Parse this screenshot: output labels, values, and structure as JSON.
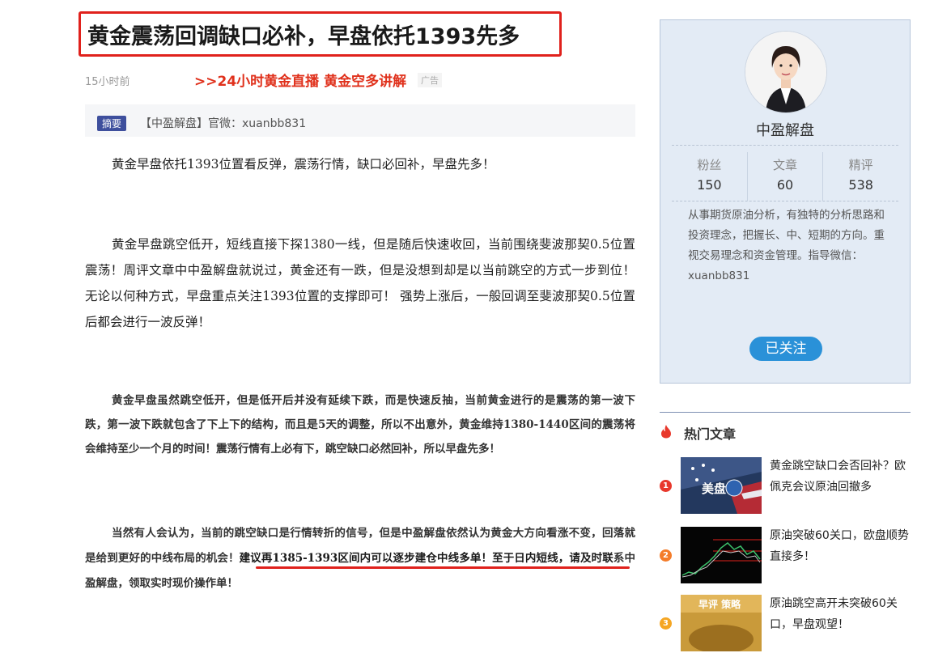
{
  "article": {
    "title": "黄金震荡回调缺口必补，早盘依托1393先多",
    "time": "15小时前",
    "ad_link": ">>24小时黄金直播 黄金空多讲解",
    "ad_tag": "广告",
    "summary_tag": "摘要",
    "summary_text": "【中盈解盘】官微：xuanbb831",
    "p1": "黄金早盘依托1393位置看反弹，震荡行情，缺口必回补，早盘先多！",
    "p2": "黄金早盘跳空低开，短线直接下探1380一线，但是随后快速收回，当前围绕斐波那契0.5位置震荡！周评文章中中盈解盘就说过，黄金还有一跌，但是没想到却是以当前跳空的方式一步到位！无论以何种方式，早盘重点关注1393位置的支撑即可！ 强势上涨后，一般回调至斐波那契0.5位置后都会进行一波反弹！",
    "p3": "黄金早盘虽然跳空低开，但是低开后并没有延续下跌，而是快速反抽，当前黄金进行的是震荡的第一波下跌，第一波下跌就包含了下上下的结构，而且是5天的调整，所以不出意外，黄金维持1380-1440区间的震荡将会维持至少一个月的时间！震荡行情有上必有下，跳空缺口必然回补，所以早盘先多！",
    "p4_a": "当然有人会认为，当前的跳空缺口是行情转折的信号，但是中盈解盘依然认为黄金大方向看涨不变，回落就是给到更好的中线布局的机会！",
    "p4_b": "建议再1385-1393区间内可以逐步建仓中线多单！至于日内短线，请及时联",
    "p4_c": "系中盈解盘，领取实时现价操作单！"
  },
  "author": {
    "name": "中盈解盘",
    "stats": [
      {
        "label": "粉丝",
        "value": "150"
      },
      {
        "label": "文章",
        "value": "60"
      },
      {
        "label": "精评",
        "value": "538"
      }
    ],
    "desc": "从事期货原油分析，有独特的分析思路和投资理念，把握长、中、短期的方向。重视交易理念和资金管理。指导微信：xuanbb831",
    "follow_label": "已关注"
  },
  "hot": {
    "title": "热门文章",
    "items": [
      {
        "num": "1",
        "text": "黄金跳空缺口会否回补？欧佩克会议原油回撤多",
        "color": "#e8382c",
        "thumb_text": "美盘"
      },
      {
        "num": "2",
        "text": "原油突破60关口，欧盘顺势直接多！",
        "color": "#f47c2a",
        "thumb_text": ""
      },
      {
        "num": "3",
        "text": "原油跳空高开未突破60关口，早盘观望！",
        "color": "#f5a623",
        "thumb_text": "早评 策略"
      }
    ]
  }
}
